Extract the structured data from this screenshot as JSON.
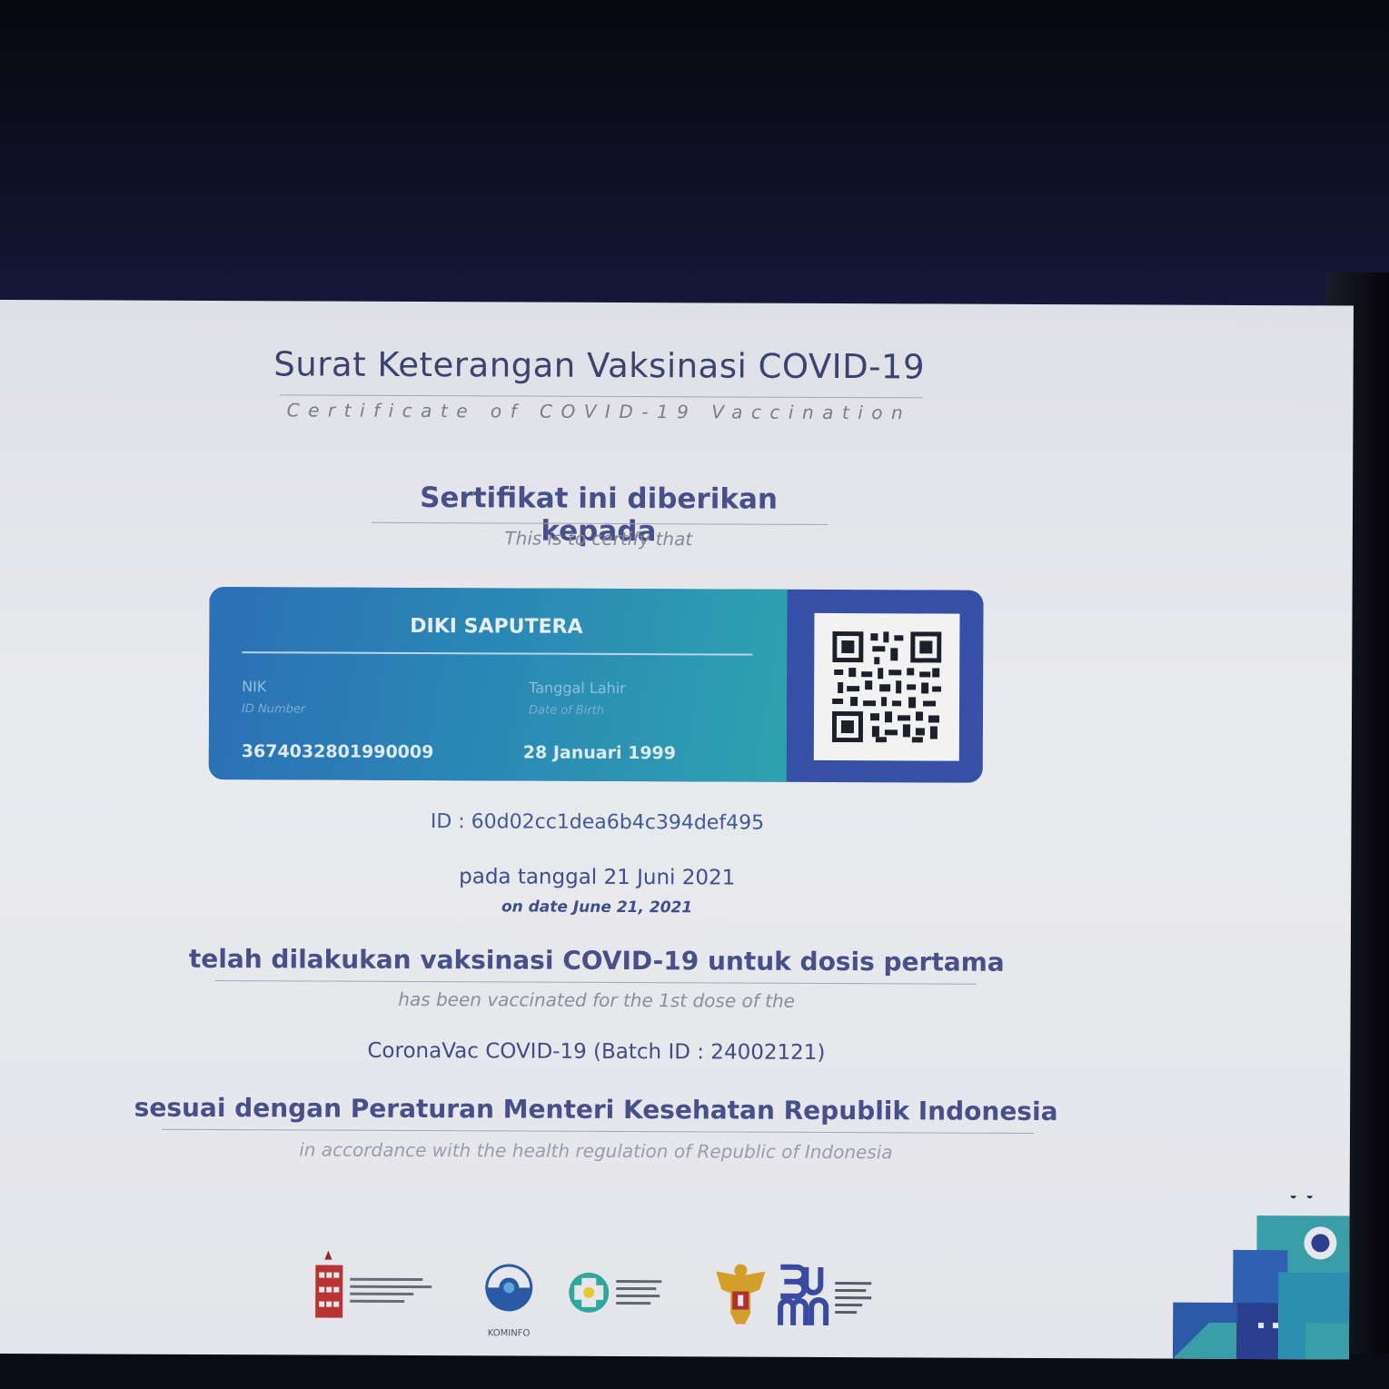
{
  "certificate": {
    "title": "Surat Keterangan Vaksinasi COVID-19",
    "subtitle": "Certificate of COVID-19 Vaccination",
    "given_to": "Sertifikat ini diberikan kepada",
    "given_to_en": "This is to certify that",
    "holder": {
      "name": "DIKI SAPUTERA",
      "nik_label": "NIK",
      "nik_label_en": "ID Number",
      "nik_value": "3674032801990009",
      "dob_label": "Tanggal Lahir",
      "dob_label_en": "Date of Birth",
      "dob_value": "28 Januari 1999"
    },
    "certificate_id": "ID : 60d02cc1dea6b4c394def495",
    "date_line": "pada tanggal 21 Juni 2021",
    "date_line_en": "on date June 21, 2021",
    "vaccinated_line": "telah dilakukan vaksinasi COVID-19 untuk dosis pertama",
    "vaccinated_line_en": "has been vaccinated for the 1st dose of the",
    "vaccine": "CoronaVac COVID-19 (Batch ID : 24002121)",
    "regulation_line": "sesuai dengan Peraturan Menteri Kesehatan Republik Indonesia",
    "regulation_line_en": "in accordance with the health regulation of Republic of Indonesia"
  },
  "logos": {
    "kominfo_caption": "KOMINFO",
    "bumn_mark": "BUMN"
  },
  "colors": {
    "title_text": "#3b4470",
    "card_gradient_start": "#2c6fb5",
    "card_gradient_end": "#2ea2b0",
    "card_frame": "#3550a6",
    "page_background": "#e5e6eb"
  }
}
